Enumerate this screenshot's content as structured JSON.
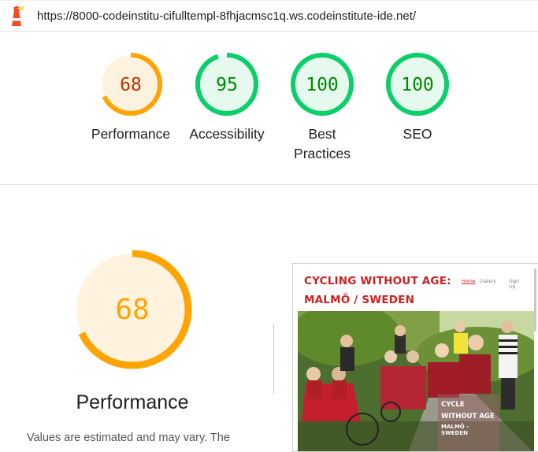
{
  "url": "https://8000-codeinstitu-cifulltempl-8fhjacmsc1q.ws.codeinstitute-ide.net/",
  "colors": {
    "average_orange": "#ffa400",
    "average_text": "#c33300",
    "average_bg": "#fff3e0",
    "pass_green": "#0cce6b",
    "pass_text": "#008800",
    "pass_bg": "#e6f9ee"
  },
  "scores": [
    {
      "id": "performance",
      "score": 68,
      "score_text": "68",
      "label": "Performance",
      "status": "average"
    },
    {
      "id": "accessibility",
      "score": 95,
      "score_text": "95",
      "label": "Accessibility",
      "status": "pass"
    },
    {
      "id": "best-practices",
      "score": 100,
      "score_text": "100",
      "label": "Best Practices",
      "status": "pass"
    },
    {
      "id": "seo",
      "score": 100,
      "score_text": "100",
      "label": "SEO",
      "status": "pass"
    }
  ],
  "detail": {
    "score": 68,
    "score_text": "68",
    "title": "Performance",
    "note": "Values are estimated and may vary. The"
  },
  "screenshot": {
    "site_title": "CYCLING WITHOUT AGE: MALMÖ / SWEDEN",
    "nav": {
      "home": "Home",
      "gallery": "Gallery",
      "signup": "Sign Up"
    },
    "caption_title": "CYCLE WITHOUT AGE",
    "caption_sub": "MALMÖ - SWEDEN"
  }
}
